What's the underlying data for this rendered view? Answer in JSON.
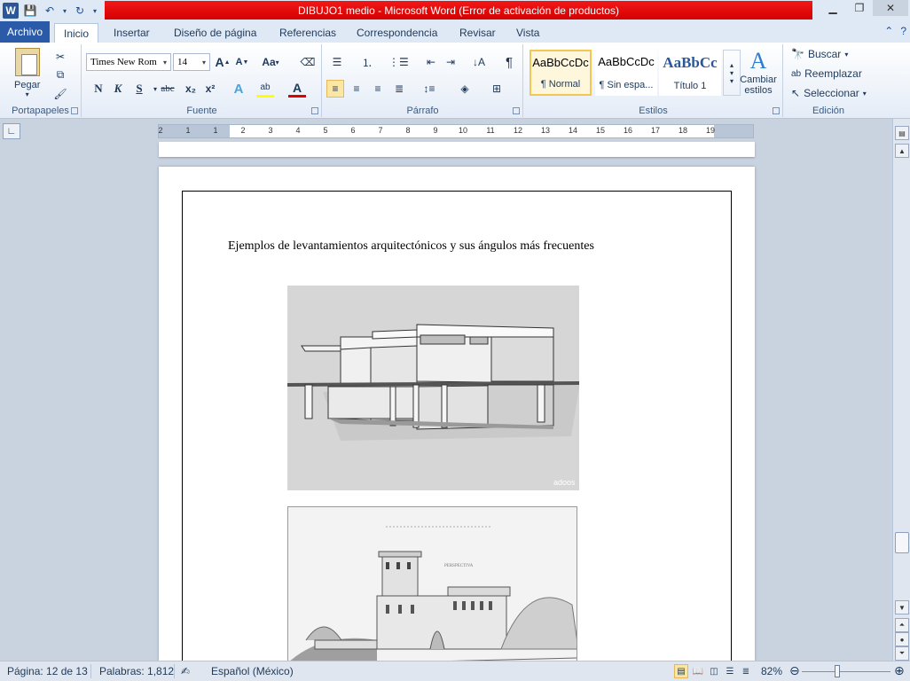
{
  "window": {
    "title": "DIBUJO1 medio  -  Microsoft Word (Error de activación de productos)"
  },
  "ribbon_tabs": [
    "Archivo",
    "Inicio",
    "Insertar",
    "Diseño de página",
    "Referencias",
    "Correspondencia",
    "Revisar",
    "Vista"
  ],
  "active_tab": "Inicio",
  "groups": {
    "clipboard": {
      "label": "Portapapeles",
      "paste": "Pegar"
    },
    "font": {
      "label": "Fuente",
      "font_name": "Times New Rom",
      "font_size": "14",
      "bold": "N",
      "italic": "K",
      "underline": "S",
      "strike": "abc",
      "sub": "x₂",
      "sup": "x²",
      "case": "Aa"
    },
    "paragraph": {
      "label": "Párrafo"
    },
    "styles": {
      "label": "Estilos",
      "items": [
        {
          "sample": "AaBbCcDc",
          "name": "¶ Normal"
        },
        {
          "sample": "AaBbCcDc",
          "name": "¶ Sin espa..."
        },
        {
          "sample": "AaBbCc",
          "name": "Título 1"
        }
      ],
      "change_styles": "Cambiar estilos"
    },
    "editing": {
      "label": "Edición",
      "find": "Buscar",
      "replace": "Reemplazar",
      "select": "Seleccionar"
    }
  },
  "ruler_ticks": [
    "2",
    "1",
    "1",
    "2",
    "3",
    "4",
    "5",
    "6",
    "7",
    "8",
    "9",
    "10",
    "11",
    "12",
    "13",
    "14",
    "15",
    "16",
    "17",
    "18",
    "19"
  ],
  "document": {
    "heading": "Ejemplos de levantamientos arquitectónicos y sus ángulos más frecuentes",
    "image1_watermark": "adoos",
    "image2_caption": "PERSPECTIVA"
  },
  "status": {
    "page": "Página: 12 de 13",
    "words": "Palabras: 1,812",
    "language": "Español (México)",
    "zoom": "82%",
    "zoom_level": 0.82
  }
}
